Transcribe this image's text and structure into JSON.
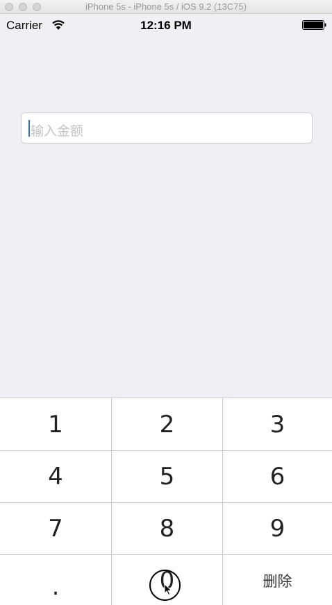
{
  "window": {
    "title": "iPhone 5s - iPhone 5s / iOS 9.2 (13C75)"
  },
  "status_bar": {
    "carrier": "Carrier",
    "time": "12:16 PM"
  },
  "amount_input": {
    "placeholder": "输入金额",
    "value": ""
  },
  "keypad": {
    "keys": [
      "1",
      "2",
      "3",
      "4",
      "5",
      "6",
      "7",
      "8",
      "9",
      ".",
      "0",
      "删除"
    ]
  },
  "colors": {
    "background": "#efeff4",
    "separator": "#c8c7cc",
    "cursor": "#2e6bd8"
  }
}
